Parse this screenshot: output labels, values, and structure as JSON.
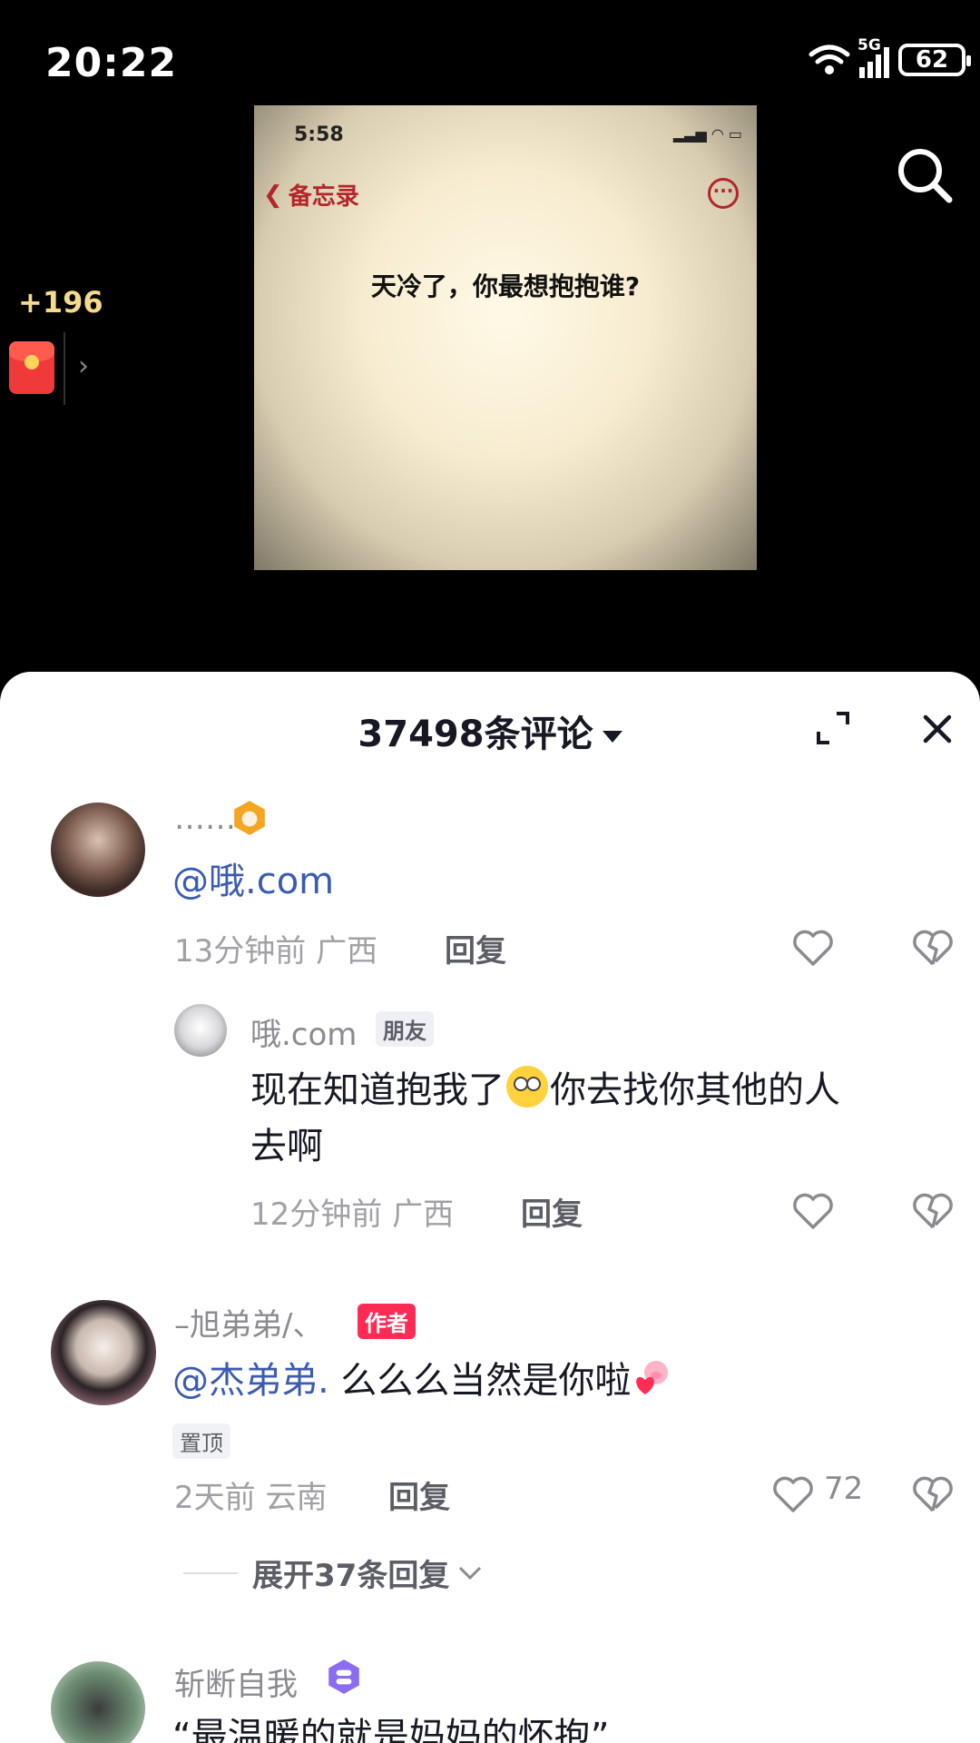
{
  "status": {
    "time": "20:22",
    "network": "5G",
    "battery": "62"
  },
  "reward": {
    "amount": "+196"
  },
  "video": {
    "time": "5:58",
    "back_label": "备忘录",
    "question": "天冷了，你最想抱抱谁?"
  },
  "comments_header": {
    "count_label": "37498条评论"
  },
  "comments": [
    {
      "username": "……",
      "text": "@哦.com",
      "time": "13分钟前",
      "location": "广西",
      "reply": "回复"
    },
    {
      "username": "哦.com",
      "badge": "朋友",
      "text_line1": "现在知道抱我了",
      "text_line1b": "你去找你其他的人",
      "text_line2": "去啊",
      "time": "12分钟前",
      "location": "广西",
      "reply": "回复"
    },
    {
      "username": "–旭弟弟/、",
      "badge": "作者",
      "mention": "@杰弟弟.",
      "text": " 么么么当然是你啦",
      "pinned": "置顶",
      "time": "2天前",
      "location": "云南",
      "reply": "回复",
      "likes": "72",
      "expand": "展开37条回复"
    },
    {
      "username": "斩断自我",
      "text": "“最温暖的就是妈妈的怀抱”"
    }
  ]
}
